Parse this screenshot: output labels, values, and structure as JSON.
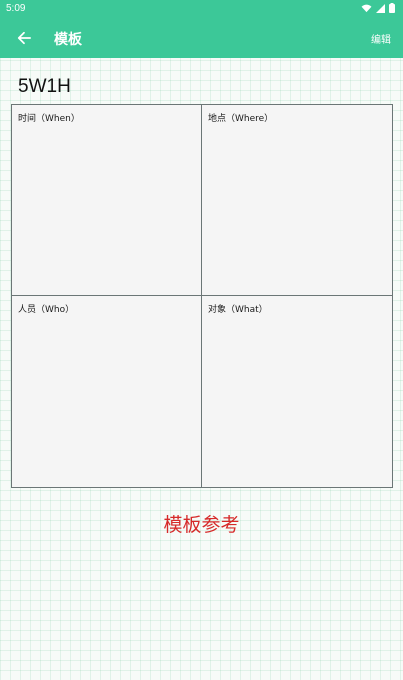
{
  "status_bar": {
    "time": "5:09",
    "icons": [
      "wifi-icon",
      "signal-icon",
      "battery-icon"
    ]
  },
  "app_bar": {
    "title": "模板",
    "edit_label": "编辑",
    "back_icon": "arrow-left-icon"
  },
  "template": {
    "title": "5W1H",
    "cells": [
      {
        "label": "时间（When）"
      },
      {
        "label": "地点（Where）"
      },
      {
        "label": "人员（Who）"
      },
      {
        "label": "对象（What）"
      }
    ]
  },
  "footer": {
    "label": "模板参考"
  },
  "colors": {
    "accent": "#3cc898",
    "footer_text": "#d62a2a",
    "grid_border": "#6b7676"
  }
}
